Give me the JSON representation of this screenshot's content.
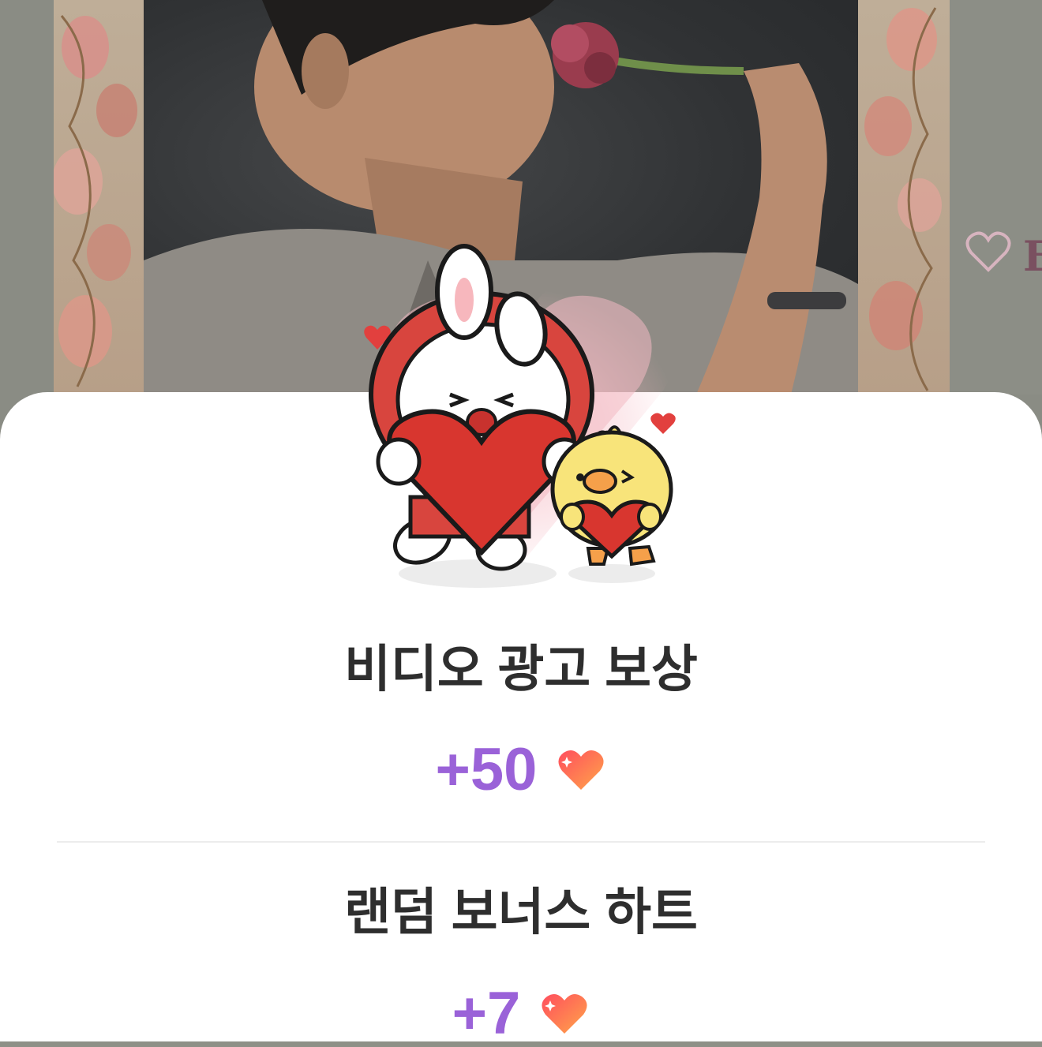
{
  "background": {
    "side_heart_icon": "heart-outline-icon",
    "side_letter": "E"
  },
  "sheet": {
    "items": [
      {
        "title": "비디오 광고 보상",
        "amount": "+50",
        "icon": "heart-icon"
      },
      {
        "title": "랜덤 보너스 하트",
        "amount": "+7",
        "icon": "heart-icon"
      }
    ]
  },
  "colors": {
    "amount": "#9a62d8",
    "title": "#2e2e2e",
    "heart_gradient_start": "#ff5a5a",
    "heart_gradient_end": "#ffa45a"
  }
}
